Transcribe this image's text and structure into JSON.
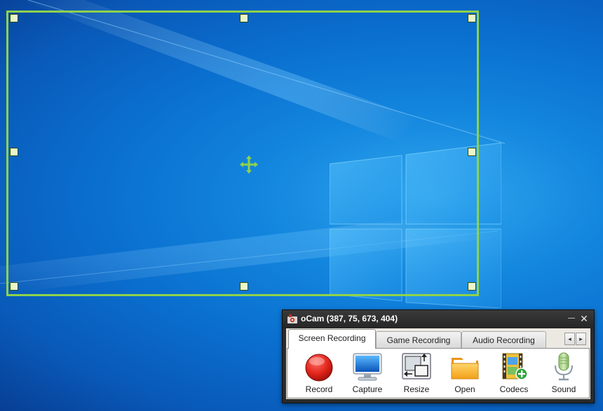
{
  "window": {
    "title": "oCam (387, 75, 673, 404)",
    "minimize_glyph": "—",
    "close_glyph": "✕"
  },
  "tabs": [
    {
      "label": "Screen Recording",
      "active": true
    },
    {
      "label": "Game Recording",
      "active": false
    },
    {
      "label": "Audio Recording",
      "active": false
    }
  ],
  "tab_scroll": {
    "left": "◂",
    "right": "▸"
  },
  "toolbar": [
    {
      "label": "Record",
      "icon": "record-icon"
    },
    {
      "label": "Capture",
      "icon": "monitor-icon"
    },
    {
      "label": "Resize",
      "icon": "resize-icon"
    },
    {
      "label": "Open",
      "icon": "folder-icon"
    },
    {
      "label": "Codecs",
      "icon": "film-plus-icon"
    },
    {
      "label": "Sound",
      "icon": "microphone-icon"
    }
  ],
  "colors": {
    "selection_border": "#8fd24a",
    "desktop_blue": "#0a6fcf",
    "record_red": "#e0231a"
  }
}
